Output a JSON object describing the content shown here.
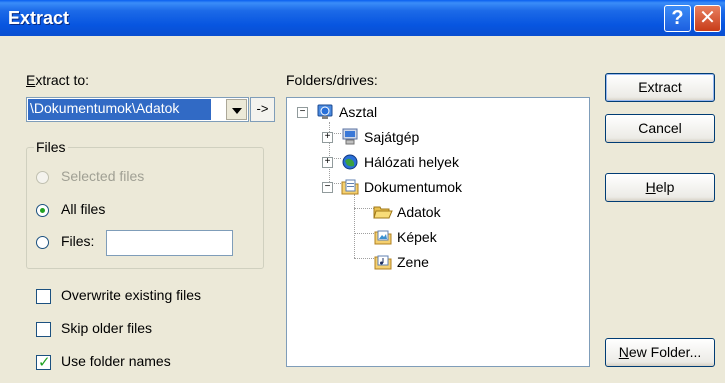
{
  "window": {
    "title": "Extract"
  },
  "extract_to": {
    "label": "Extract to:",
    "path_value": "\\Dokumentumok\\Adatok",
    "go_label": "->"
  },
  "files_group": {
    "title": "Files",
    "options": [
      {
        "label": "Selected files",
        "checked": false,
        "disabled": true
      },
      {
        "label": "All files",
        "checked": true,
        "disabled": false
      },
      {
        "label": "Files:",
        "checked": false,
        "disabled": false
      }
    ],
    "files_value": ""
  },
  "checkboxes": [
    {
      "label": "Overwrite existing files",
      "checked": false
    },
    {
      "label": "Skip older files",
      "checked": false
    },
    {
      "label": "Use folder names",
      "checked": true
    }
  ],
  "folders": {
    "label": "Folders/drives:",
    "tree": [
      {
        "label": "Asztal",
        "icon": "desktop-icon"
      },
      {
        "label": "Sajátgép",
        "icon": "my-computer-icon"
      },
      {
        "label": "Hálózati helyek",
        "icon": "network-places-icon"
      },
      {
        "label": "Dokumentumok",
        "icon": "my-documents-icon"
      },
      {
        "label": "Adatok",
        "icon": "folder-icon"
      },
      {
        "label": "Képek",
        "icon": "pictures-folder-icon"
      },
      {
        "label": "Zene",
        "icon": "music-folder-icon"
      }
    ]
  },
  "buttons": {
    "extract": "Extract",
    "cancel": "Cancel",
    "help": "Help",
    "new_folder": "New Folder..."
  },
  "colors": {
    "titlebar": "#0755e0",
    "selection": "#316ac5",
    "dialog_bg": "#ece9d8"
  }
}
